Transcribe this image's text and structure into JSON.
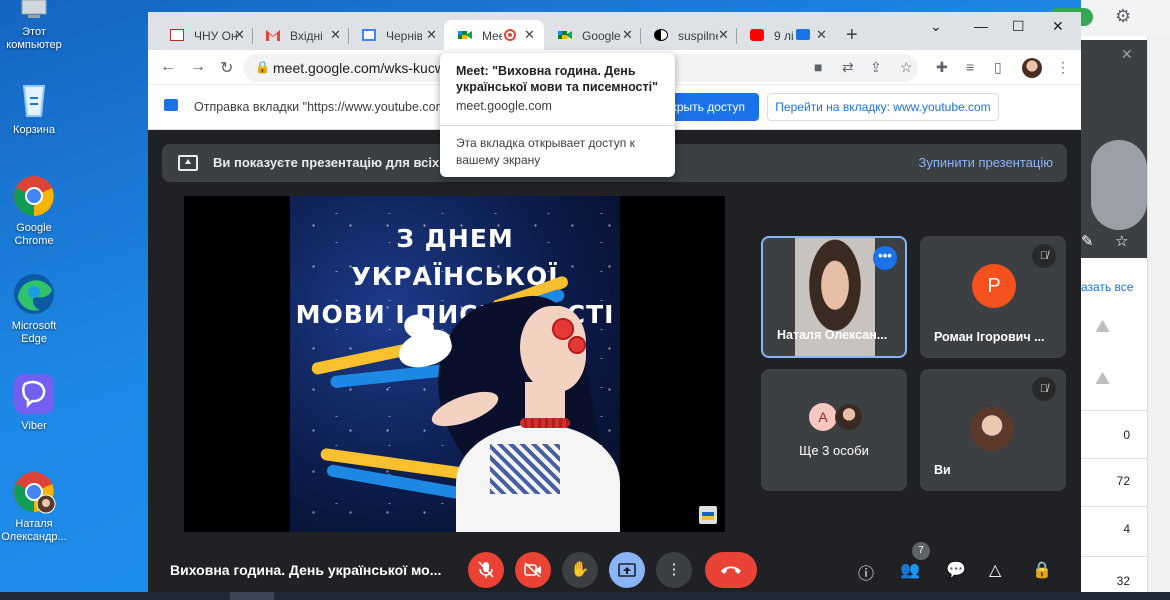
{
  "desktop": {
    "icons": [
      {
        "label": "Этот компьютер"
      },
      {
        "label": "Корзина"
      },
      {
        "label": "Google Chrome"
      },
      {
        "label": "Microsoft Edge"
      },
      {
        "label": "Viber"
      },
      {
        "label": "Наталя Олександр..."
      }
    ]
  },
  "browser": {
    "tabs": [
      {
        "title": "ЧНУ Он",
        "icon": "university-icon"
      },
      {
        "title": "Вхідні (",
        "icon": "gmail-icon"
      },
      {
        "title": "Чернів",
        "icon": "calendar-icon"
      },
      {
        "title": "Mee",
        "icon": "meet-icon",
        "active": true
      },
      {
        "title": "Google",
        "icon": "meet-icon"
      },
      {
        "title": "suspilne",
        "icon": "suspilne-icon"
      },
      {
        "title": "9 лі",
        "icon": "youtube-icon"
      }
    ],
    "url": "meet.google.com/wks-kucw-",
    "infobar": {
      "message": "Отправка вкладки \"https://www.youtube.com\"",
      "share_button": "крыть доступ",
      "switch_button": "Перейти на вкладку: www.youtube.com"
    },
    "tooltip": {
      "title": "Meet: \"Виховна година. День української мови та писемності\"",
      "domain": "meet.google.com",
      "note": "Эта вкладка открывает доступ к вашему экрану"
    }
  },
  "meet": {
    "banner": {
      "text": "Ви показуєте презентацію для всіх",
      "stop": "Зупинити презентацію"
    },
    "slide": {
      "line1": "З ДНЕМ УКРАЇНСЬКОЇ",
      "line2": "МОВИ І ПИСЕМНОСТІ"
    },
    "participants": [
      {
        "name": "Наталя Олексан..."
      },
      {
        "name": "Роман Ігорович ...",
        "initial": "Р"
      },
      {
        "name": "Ще 3 особи",
        "initial": "А"
      },
      {
        "name": "Ви"
      }
    ],
    "meeting_title": "Виховна година. День української мо...",
    "people_count": "7"
  },
  "background_window": {
    "link": "азать все",
    "numbers": [
      "0",
      "72",
      "4",
      "32"
    ]
  },
  "colors": {
    "meet_bg": "#202124",
    "red": "#ea4335",
    "accent_blue": "#8ab4f8",
    "chrome_blue": "#1a73e8"
  }
}
